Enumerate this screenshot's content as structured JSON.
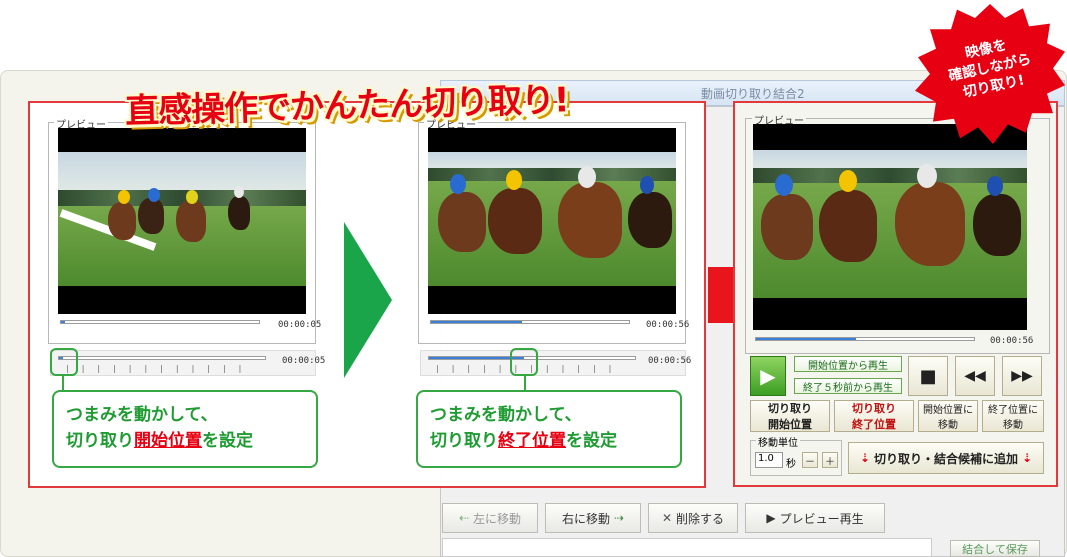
{
  "headline": "直感操作でかんたん切り取り!",
  "burst": {
    "line1": "映像を",
    "line2": "確認しながら",
    "line3": "切り取り!"
  },
  "window": {
    "title": "動画切り取り結合2"
  },
  "preview_label": "プレビュー",
  "panel1": {
    "time_small": "00:00:05",
    "time_large": "00:00:05",
    "slider_progress": 0.02
  },
  "panel2": {
    "time_small": "00:00:56",
    "time_large": "00:00:56",
    "slider_progress": 0.46
  },
  "callout1": {
    "line1": "つまみを動かして、",
    "prefix": "切り取り",
    "highlight": "開始位置",
    "suffix": "を設定"
  },
  "callout2": {
    "line1": "つまみを動かして、",
    "prefix": "切り取り",
    "highlight": "終了位置",
    "suffix": "を設定"
  },
  "right_panel": {
    "time": "00:00:56",
    "play_from_start": "開始位置から再生",
    "play_5sec_before_end": "終了５秒前から再生",
    "cut_start_l1": "切り取り",
    "cut_start_l2": "開始位置",
    "cut_end_l1": "切り取り",
    "cut_end_l2": "終了位置",
    "move_to_start_l1": "開始位置に",
    "move_to_start_l2": "移動",
    "move_to_end_l1": "終了位置に",
    "move_to_end_l2": "移動",
    "move_unit_label": "移動単位",
    "move_unit_value": "1.0",
    "seconds": "秒",
    "minus": "－",
    "plus": "＋",
    "add_candidate": "切り取り・結合候補に追加"
  },
  "bottom_toolbar": {
    "move_left": "左に移動",
    "move_right": "右に移動",
    "delete": "削除する",
    "preview_play": "プレビュー再生",
    "combine_save": "結合して保存"
  },
  "colors": {
    "accent_red": "#e60012",
    "accent_green": "#1aa54b"
  }
}
